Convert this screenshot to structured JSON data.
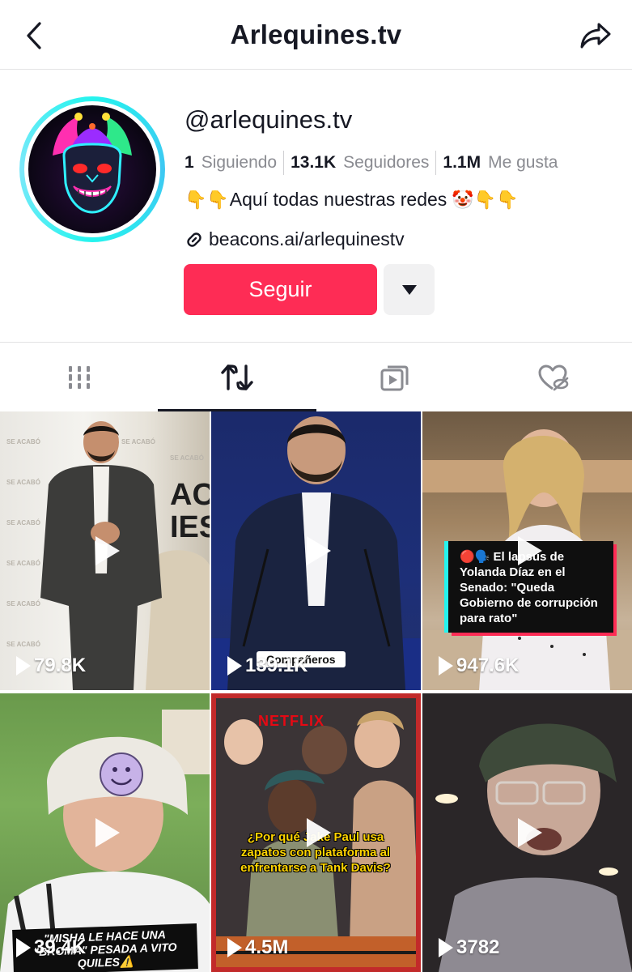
{
  "header": {
    "title": "Arlequines.tv"
  },
  "profile": {
    "handle": "@arlequines.tv",
    "stats": [
      {
        "value": "1",
        "label": "Siguiendo"
      },
      {
        "value": "13.1K",
        "label": "Seguidores"
      },
      {
        "value": "1.1M",
        "label": "Me gusta"
      }
    ],
    "bio": {
      "prefix_emoji": "👇👇",
      "text": "Aquí todas nuestras redes",
      "suffix_emoji": "🤡👇👇"
    },
    "link": "beacons.ai/arlequinestv",
    "follow_label": "Seguir"
  },
  "tabs": [
    {
      "name": "videos",
      "icon": "grid-bars-icon",
      "active": false
    },
    {
      "name": "reposts",
      "icon": "repost-icon",
      "active": true
    },
    {
      "name": "collections",
      "icon": "playlist-icon",
      "active": false
    },
    {
      "name": "liked",
      "icon": "hidden-heart-icon",
      "active": false
    }
  ],
  "videos": [
    {
      "views": "79.8K"
    },
    {
      "views": "139.1K",
      "overlay": "Compañeros"
    },
    {
      "views": "947.6K",
      "caption": "🔴🗣️ El lapsus de Yolanda Díaz en el Senado: \"Queda Gobierno de corrupción para rato\""
    },
    {
      "views": "39.4K",
      "caption": "\"MISHA LE HACE UNA \"BROMA\" PESADA A VITO QUILES⚠️"
    },
    {
      "views": "4.5M",
      "caption": "¿Por qué Jake Paul usa zapatos con plataforma al enfrentarse a Tank Davis?",
      "badge": "NETFLIX"
    },
    {
      "views": "3782"
    }
  ],
  "colors": {
    "follow_button": "#fe2c55",
    "avatar_ring": "#25f4ee",
    "text_primary": "#161823",
    "text_secondary": "#8a8b91"
  }
}
